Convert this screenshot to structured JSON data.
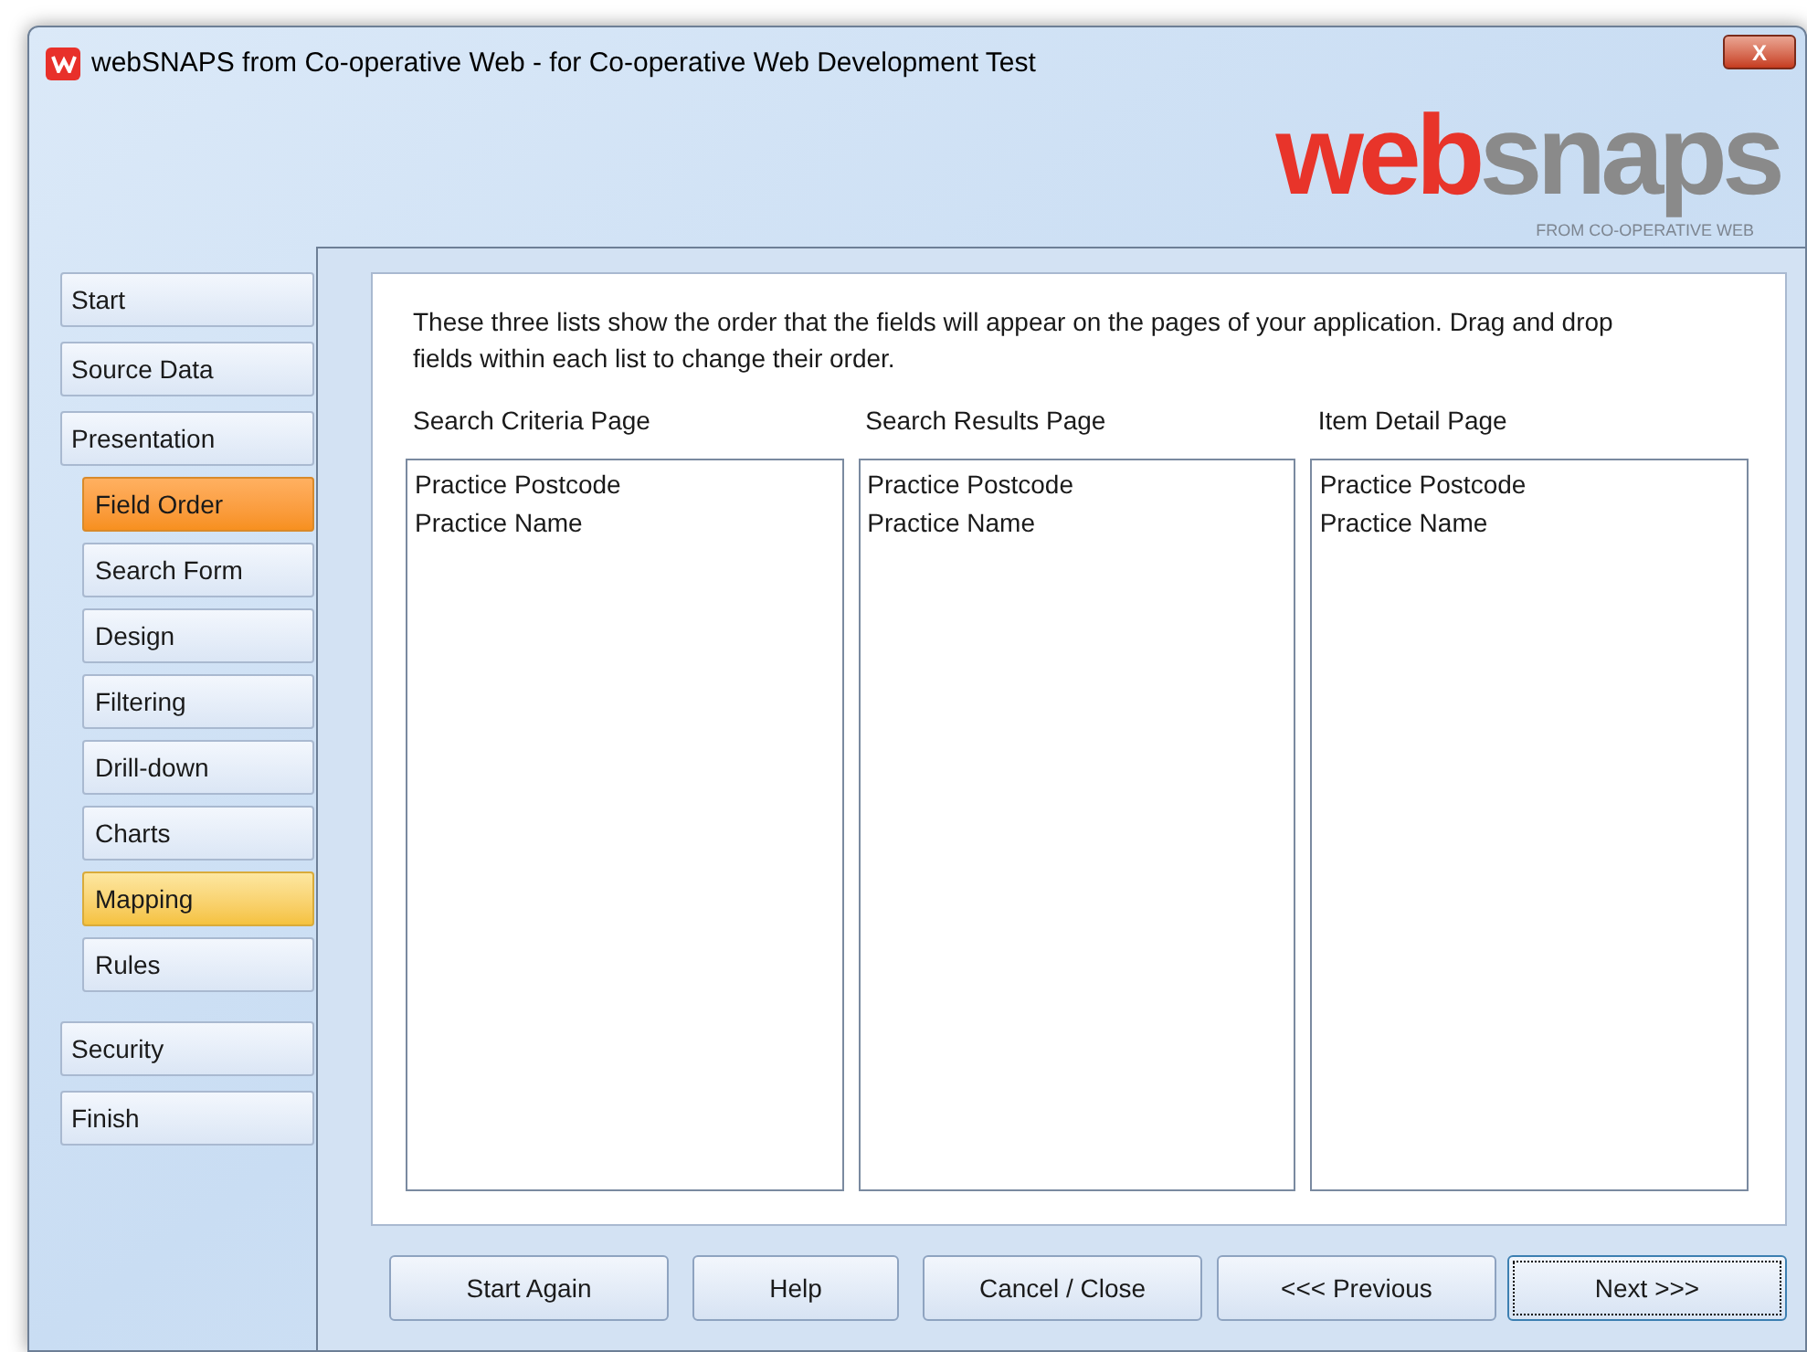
{
  "window": {
    "title": "webSNAPS from Co-operative Web - for Co-operative Web Development Test",
    "close": "X"
  },
  "logo": {
    "word_left": "web",
    "word_right": "snaps",
    "tagline": "FROM CO-OPERATIVE WEB"
  },
  "sidebar": {
    "items": [
      {
        "label": "Start",
        "selected": false,
        "hovered": false
      },
      {
        "label": "Source Data",
        "selected": false,
        "hovered": false
      },
      {
        "label": "Presentation",
        "selected": false,
        "hovered": false,
        "children": [
          {
            "label": "Field Order",
            "selected": true,
            "hovered": false
          },
          {
            "label": "Search Form",
            "selected": false,
            "hovered": false
          },
          {
            "label": "Design",
            "selected": false,
            "hovered": false
          },
          {
            "label": "Filtering",
            "selected": false,
            "hovered": false
          },
          {
            "label": "Drill-down",
            "selected": false,
            "hovered": false
          },
          {
            "label": "Charts",
            "selected": false,
            "hovered": false
          },
          {
            "label": "Mapping",
            "selected": false,
            "hovered": true
          },
          {
            "label": "Rules",
            "selected": false,
            "hovered": false
          }
        ]
      },
      {
        "label": "Security",
        "selected": false,
        "hovered": false
      },
      {
        "label": "Finish",
        "selected": false,
        "hovered": false
      }
    ]
  },
  "instructions": "These three lists show the order that the fields will appear on the pages of your application.  Drag and drop fields within each list to change their order.",
  "lists": [
    {
      "title": "Search Criteria Page",
      "items": [
        "Practice Postcode",
        "Practice Name"
      ]
    },
    {
      "title": "Search Results Page",
      "items": [
        "Practice Postcode",
        "Practice Name"
      ]
    },
    {
      "title": "Item Detail Page",
      "items": [
        "Practice Postcode",
        "Practice Name"
      ]
    }
  ],
  "buttons_left": [
    {
      "label": "Start Again",
      "focused": false
    },
    {
      "label": "Help",
      "focused": false
    },
    {
      "label": "Cancel / Close",
      "focused": false
    }
  ],
  "buttons_right": [
    {
      "label": "<<< Previous",
      "focused": false
    },
    {
      "label": "Next >>>",
      "focused": true
    }
  ]
}
